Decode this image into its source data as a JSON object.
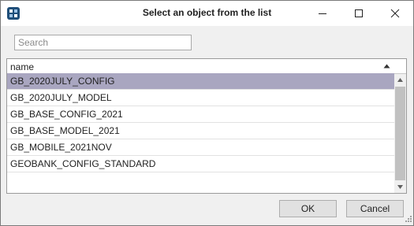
{
  "window": {
    "title": "Select an object from the list",
    "app_icon": "app-logo-icon",
    "controls": [
      "minimize-icon",
      "maximize-icon",
      "close-icon"
    ]
  },
  "search": {
    "placeholder": "Search",
    "value": ""
  },
  "list": {
    "column_header": "name",
    "sort": "ascending",
    "rows": [
      "GB_2020JULY_CONFIG",
      "GB_2020JULY_MODEL",
      "GB_BASE_CONFIG_2021",
      "GB_BASE_MODEL_2021",
      "GB_MOBILE_2021NOV",
      "GEOBANK_CONFIG_STANDARD"
    ],
    "selected_row": "GB_2020JULY_CONFIG"
  },
  "buttons": {
    "ok_label": "OK",
    "cancel_label": "Cancel"
  },
  "colors": {
    "selection": "#a9a6c0",
    "app_icon": "#1f4e79"
  }
}
